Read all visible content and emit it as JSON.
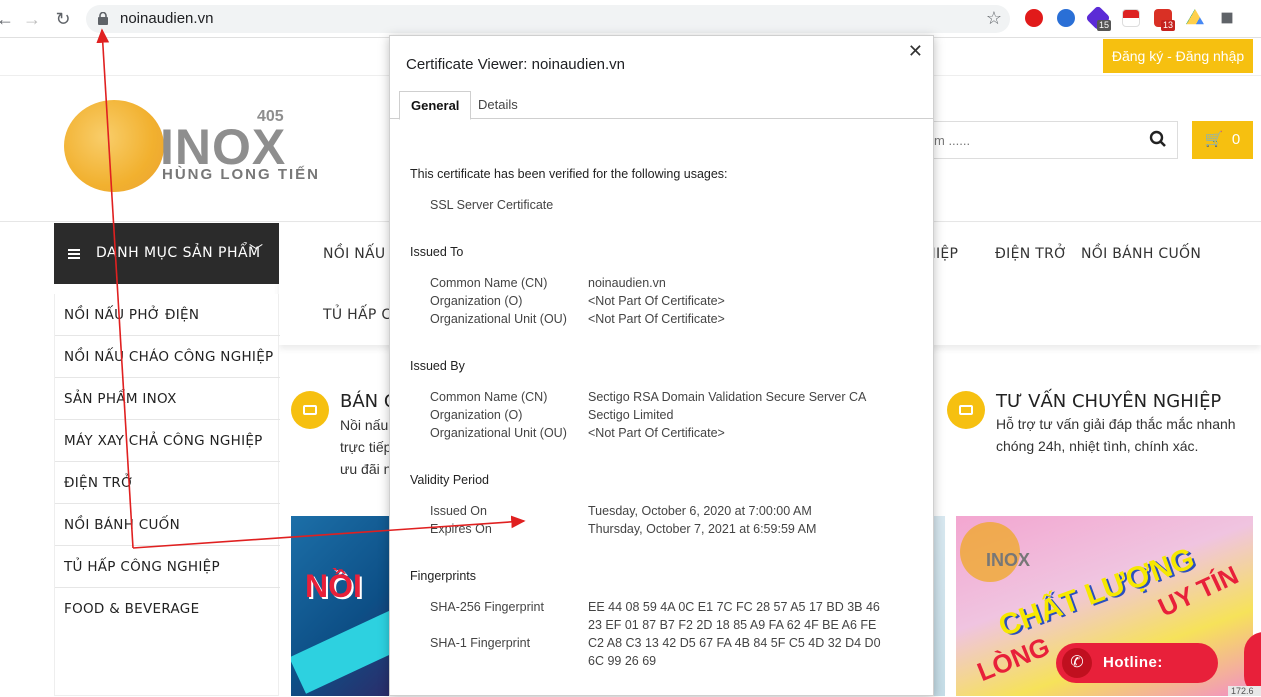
{
  "browser": {
    "url": "noinaudien.vn",
    "extensions": [
      {
        "name": "opera-red-icon",
        "color": "#e11a1a"
      },
      {
        "name": "ip-icon",
        "color": "#2a6fd6"
      },
      {
        "name": "puzzle-purple-icon",
        "color": "#5b2bd6",
        "badge": "15"
      },
      {
        "name": "flag-icon",
        "color": "#d22"
      },
      {
        "name": "gmail-icon",
        "color": "#d93025",
        "badge": "13"
      },
      {
        "name": "drive-icon",
        "color": "#1fa463"
      },
      {
        "name": "extensions-icon",
        "color": "#5f6368"
      }
    ]
  },
  "site": {
    "login_label": "Đăng ký - Đăng nhập",
    "logo": {
      "brand": "INOX",
      "number": "405",
      "sub": "HÙNG LONG TIẾN"
    },
    "search_placeholder": "m ......",
    "cart_count": "0",
    "category_header": "DANH MỤC SẢN PHẨM",
    "main_nav": [
      "NỒI NẤU PI",
      "GHIỆP",
      "ĐIỆN TRỞ",
      "NỒI BÁNH CUỐN",
      "TỦ HẤP CÔ"
    ],
    "categories": [
      "NỒI NẤU PHỞ ĐIỆN",
      "NỒI NẤU CHÁO CÔNG NGHIỆP",
      "SẢN PHẨM INOX",
      "MÁY XAY CHẢ CÔNG NGHIỆP",
      "ĐIỆN TRỞ",
      "NỒI BÁNH CUỐN",
      "TỦ HẤP CÔNG NGHIỆP",
      "FOOD & BEVERAGE"
    ],
    "feature_left": {
      "title": "BÁN CH",
      "desc1": "Nồi nấu",
      "desc2": "trực tiếp",
      "desc3": "ưu đãi n"
    },
    "feature_right": {
      "title": "TƯ VẤN CHUYÊN NGHIỆP",
      "desc1": "Hỗ trợ tư vấn giải đáp thắc mắc nhanh",
      "desc2": "chóng 24h, nhiệt tình, chính xác."
    },
    "banner_left_text": "NỒI",
    "banner_right": {
      "logo": "INOX",
      "line1": "CHẤT LƯỢNG",
      "line2": "UY TÍN",
      "line3": "LÒNG"
    },
    "hotline_label": "Hotline:",
    "corner_tag": "172.6",
    "accent_color": "#f6c010"
  },
  "certificate": {
    "title": "Certificate Viewer: noinaudien.vn",
    "tabs": [
      "General",
      "Details"
    ],
    "verified_text": "This certificate has been verified for the following usages:",
    "usage": "SSL Server Certificate",
    "issued_to": {
      "heading": "Issued To",
      "rows": [
        {
          "k": "Common Name (CN)",
          "v": "noinaudien.vn"
        },
        {
          "k": "Organization (O)",
          "v": "<Not Part Of Certificate>"
        },
        {
          "k": "Organizational Unit (OU)",
          "v": "<Not Part Of Certificate>"
        }
      ]
    },
    "issued_by": {
      "heading": "Issued By",
      "rows": [
        {
          "k": "Common Name (CN)",
          "v": "Sectigo RSA Domain Validation Secure Server CA"
        },
        {
          "k": "Organization (O)",
          "v": "Sectigo Limited"
        },
        {
          "k": "Organizational Unit (OU)",
          "v": "<Not Part Of Certificate>"
        }
      ]
    },
    "validity": {
      "heading": "Validity Period",
      "rows": [
        {
          "k": "Issued On",
          "v": "Tuesday, October 6, 2020 at 7:00:00 AM"
        },
        {
          "k": "Expires On",
          "v": "Thursday, October 7, 2021 at 6:59:59 AM"
        }
      ]
    },
    "fingerprints": {
      "heading": "Fingerprints",
      "sha256_label": "SHA-256 Fingerprint",
      "sha256_line1": "EE 44 08 59 4A 0C E1 7C FC 28 57 A5 17 BD 3B 46",
      "sha256_line2": "23 EF 01 87 B7 F2 2D 18 85 A9 FA 62 4F BE A6 FE",
      "sha1_label": "SHA-1 Fingerprint",
      "sha1_line1": "C2 A8 C3 13 42 D5 67 FA 4B 84 5F C5 4D 32 D4 D0",
      "sha1_line2": "6C 99 26 69"
    }
  },
  "annotation_color": "#e02020"
}
